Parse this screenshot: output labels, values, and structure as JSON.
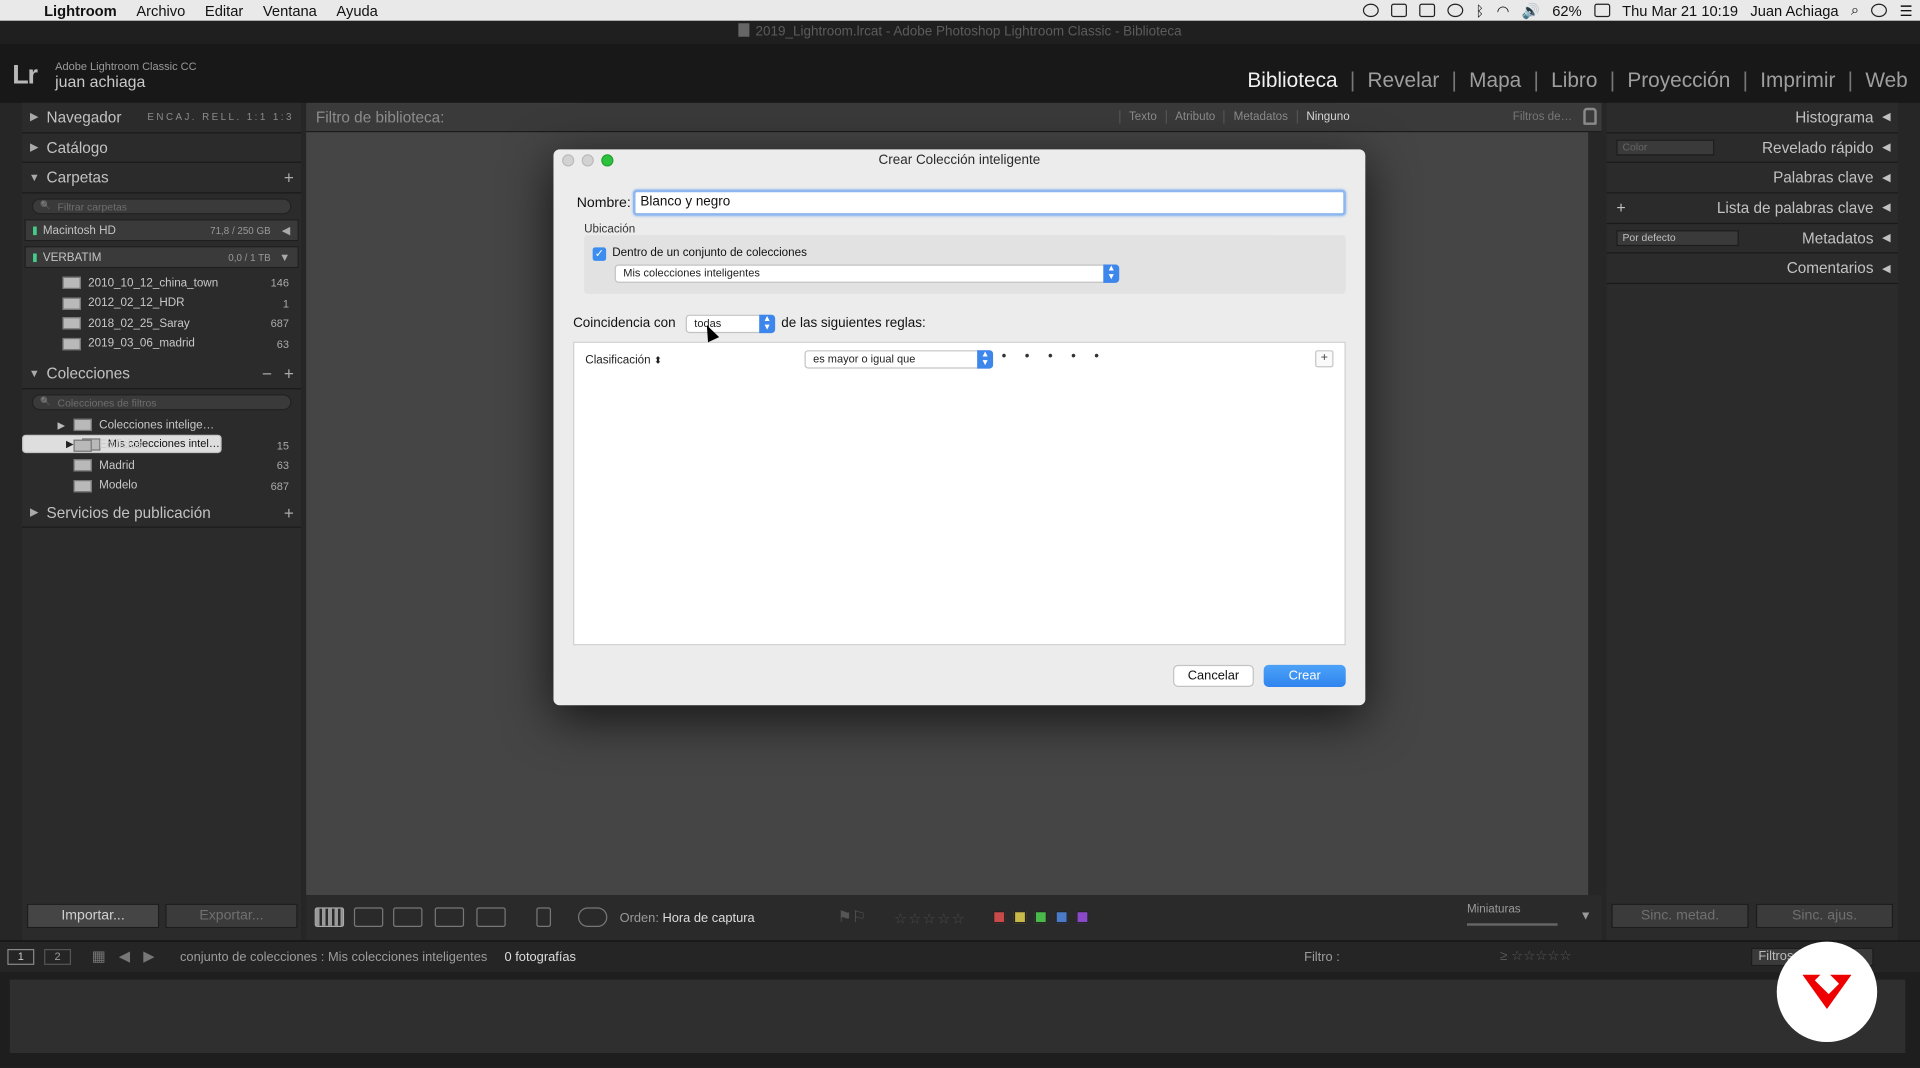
{
  "menubar": {
    "app": "Lightroom",
    "menus": [
      "Archivo",
      "Editar",
      "Ventana",
      "Ayuda"
    ],
    "battery": "62%",
    "clock": "Thu Mar 21  10:19",
    "user": "Juan Achiaga"
  },
  "window_title": "2019_Lightroom.lrcat - Adobe Photoshop Lightroom Classic - Biblioteca",
  "identity": {
    "product": "Adobe Lightroom Classic CC",
    "user": "juan achiaga",
    "logo": "Lr"
  },
  "modules": [
    "Biblioteca",
    "Revelar",
    "Mapa",
    "Libro",
    "Proyección",
    "Imprimir",
    "Web"
  ],
  "active_module": "Biblioteca",
  "left_panel": {
    "navigator": "Navegador",
    "navigator_opts": "ENCAJ.  RELL.  1:1  1:3",
    "catalog": "Catálogo",
    "folders": "Carpetas",
    "folders_search": "Filtrar carpetas",
    "volumes": [
      {
        "name": "Macintosh HD",
        "size": "71,8 / 250 GB"
      },
      {
        "name": "VERBATIM",
        "size": "0,0 / 1 TB"
      }
    ],
    "folder_items": [
      {
        "name": "2010_10_12_china_town",
        "count": "146"
      },
      {
        "name": "2012_02_12_HDR",
        "count": "1"
      },
      {
        "name": "2018_02_25_Saray",
        "count": "687"
      },
      {
        "name": "2019_03_06_madrid",
        "count": "63"
      }
    ],
    "collections": "Colecciones",
    "collections_search": "Colecciones de filtros",
    "collection_items": [
      {
        "name": "Colecciones intelige…",
        "count": ""
      },
      {
        "name": "Mis colecciones intel…",
        "count": ""
      },
      {
        "name": "Edificios",
        "count": "15"
      },
      {
        "name": "Madrid",
        "count": "63"
      },
      {
        "name": "Modelo",
        "count": "687"
      }
    ],
    "publish": "Servicios de publicación",
    "import": "Importar...",
    "export": "Exportar..."
  },
  "right_panel": {
    "sections": [
      "Histograma",
      "Revelado rápido",
      "Palabras clave",
      "Lista de palabras clave",
      "Metadatos",
      "Comentarios"
    ],
    "quick_dev_select": "Color",
    "metadata_select": "Por defecto",
    "sync_meta": "Sinc. metad.",
    "sync_settings": "Sinc. ajus."
  },
  "filterbar": {
    "label": "Filtro de biblioteca:",
    "tabs": [
      "Texto",
      "Atributo",
      "Metadatos",
      "Ninguno"
    ],
    "active_tab": "Ninguno",
    "presets": "Filtros de…"
  },
  "toolbar": {
    "sort_label": "Orden:",
    "sort_value": "Hora de captura",
    "thumbnails": "Miniaturas",
    "label_colors": [
      "#c84a4a",
      "#c8b84a",
      "#4ab84a",
      "#4a7ac8",
      "#8a4ac8"
    ]
  },
  "filmstrip": {
    "source": "conjunto de colecciones : Mis colecciones inteligentes",
    "count": "0 fotografías",
    "filter_label": "Filtro :",
    "filter_value": "Filtros"
  },
  "dialog": {
    "title": "Crear Colección inteligente",
    "name_label": "Nombre:",
    "name_value": "Blanco y negro",
    "location_label": "Ubicación",
    "inside_set_label": "Dentro de un conjunto de colecciones",
    "inside_set_checked": true,
    "set_select": "Mis colecciones inteligentes",
    "match_label": "Coincidencia con",
    "match_value": "todas",
    "match_suffix": "de las siguientes reglas:",
    "rule_field": "Clasificación",
    "rule_operator": "es mayor o igual que",
    "rule_dots": "• • • • •",
    "add_rule": "+",
    "cancel": "Cancelar",
    "create": "Crear"
  }
}
